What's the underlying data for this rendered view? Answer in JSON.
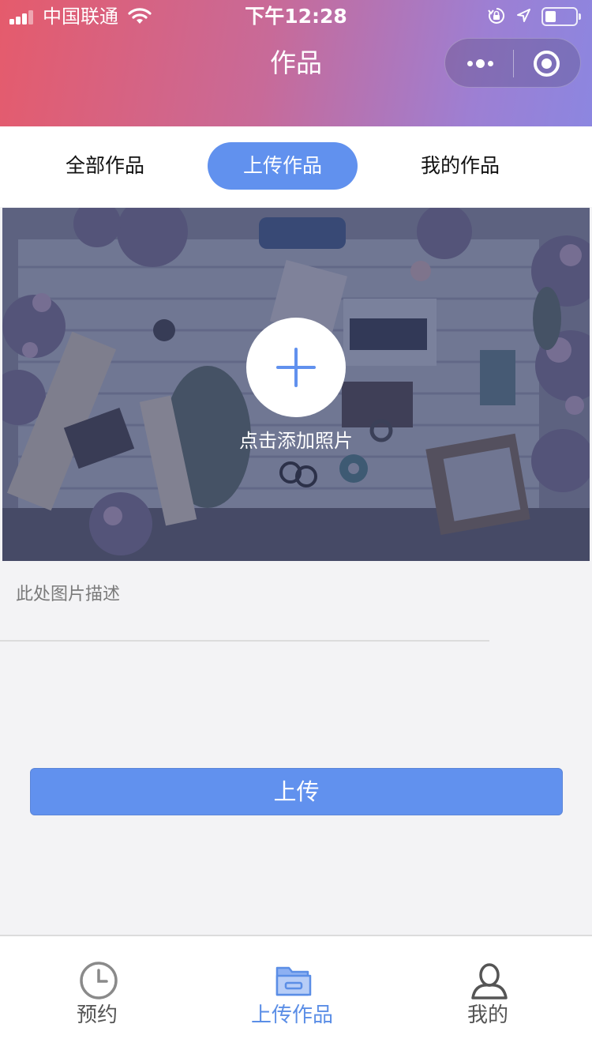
{
  "status_bar": {
    "carrier": "中国联通",
    "time": "下午12:28",
    "battery_level": 0.35
  },
  "nav": {
    "title": "作品"
  },
  "tabs": [
    {
      "label": "全部作品",
      "active": false
    },
    {
      "label": "上传作品",
      "active": true
    },
    {
      "label": "我的作品",
      "active": false
    }
  ],
  "upload": {
    "add_label": "点击添加照片",
    "description_placeholder": "此处图片描述",
    "description_value": "",
    "submit_label": "上传"
  },
  "tabbar": [
    {
      "label": "预约",
      "icon": "clock-icon",
      "active": false
    },
    {
      "label": "上传作品",
      "icon": "folder-icon",
      "active": true
    },
    {
      "label": "我的",
      "icon": "user-icon",
      "active": false
    }
  ],
  "colors": {
    "accent": "#6191ee",
    "header_gradient_start": "#e55b6c",
    "header_gradient_end": "#8c86e0",
    "tabbar_active": "#5b8ee6",
    "tabbar_inactive": "#555555"
  }
}
